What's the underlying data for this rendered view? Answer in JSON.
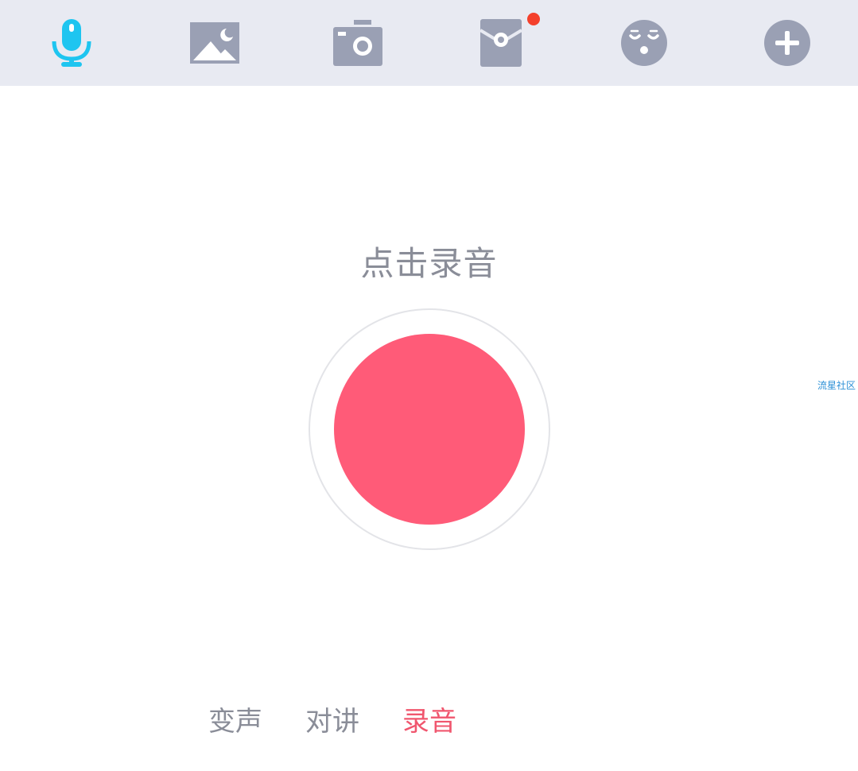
{
  "toolbar": {
    "items": [
      {
        "icon": "microphone-icon",
        "active": true
      },
      {
        "icon": "image-icon",
        "active": false
      },
      {
        "icon": "camera-icon",
        "active": false
      },
      {
        "icon": "red-envelope-icon",
        "active": false,
        "badge": true
      },
      {
        "icon": "emoji-icon",
        "active": false
      },
      {
        "icon": "plus-icon",
        "active": false
      }
    ],
    "active_color": "#1ec5f0",
    "inactive_color": "#9aa0b4",
    "badge_color": "#f4402c"
  },
  "recorder": {
    "hint": "点击录音",
    "button_color": "#ff5b78"
  },
  "watermark": "流星社区",
  "modes": {
    "items": [
      {
        "label": "变声",
        "active": false
      },
      {
        "label": "对讲",
        "active": false
      },
      {
        "label": "录音",
        "active": true
      }
    ],
    "active_color": "#f0566e"
  }
}
